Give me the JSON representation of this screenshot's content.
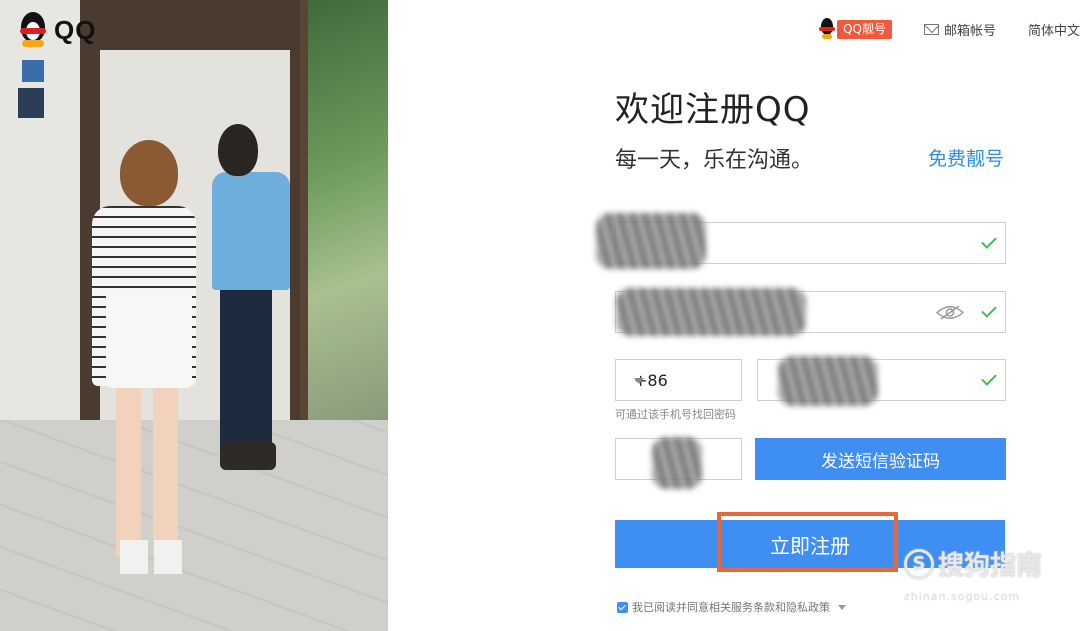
{
  "brand": {
    "logo_text": "QQ"
  },
  "topnav": {
    "qq_lianghao": "QQ靓号",
    "mail_account": "邮箱帐号",
    "language": "简体中文"
  },
  "form": {
    "title": "欢迎注册QQ",
    "subtitle": "每一天，乐在沟通。",
    "free_link": "免费靓号",
    "country_code": "+86",
    "phone_hint": "可通过该手机号找回密码",
    "sms_button": "发送短信验证码",
    "register_button": "立即注册",
    "agreement": "我已阅读并同意相关服务条款和隐私政策"
  },
  "watermark": {
    "text": "搜狗指南",
    "url": "zhinan.sogou.com"
  },
  "colors": {
    "primary": "#3f8ef2",
    "link": "#2b8fe3",
    "badge": "#f0593c",
    "highlight": "#e8683a",
    "check": "#3cbd5a"
  }
}
